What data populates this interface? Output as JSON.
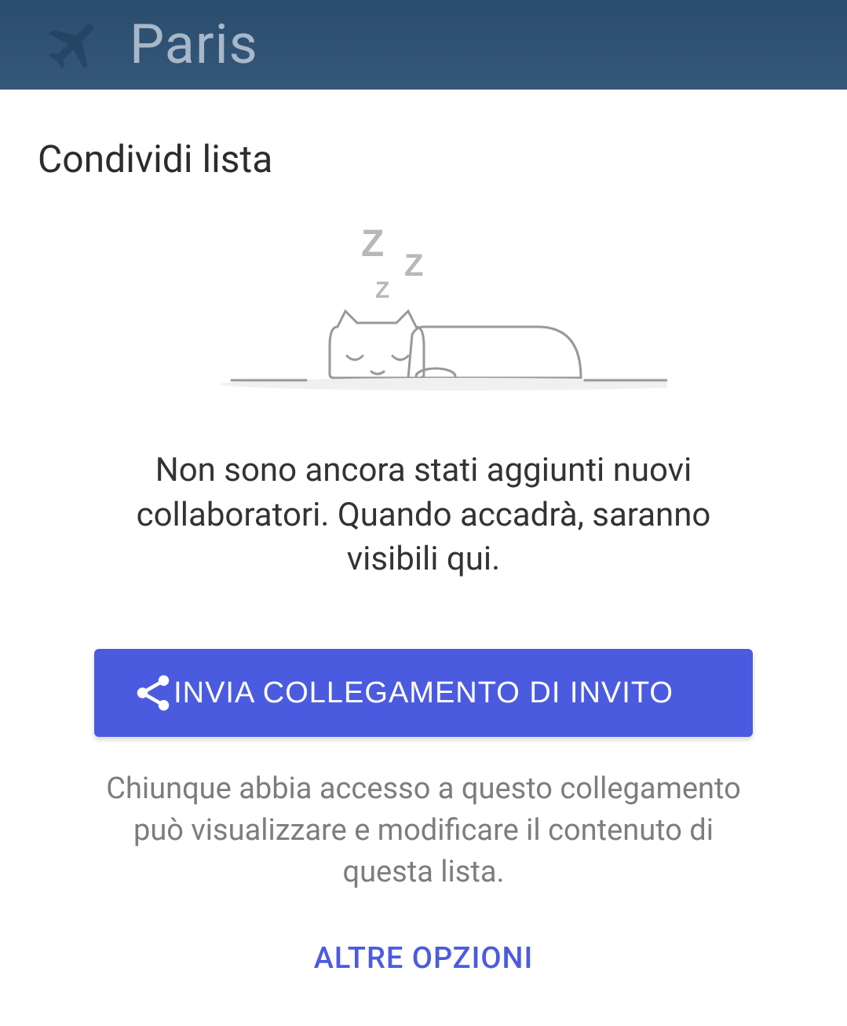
{
  "header": {
    "title": "Paris"
  },
  "page": {
    "title": "Condividi lista",
    "empty_state_message": "Non sono ancora stati aggiunti nuovi collaboratori. Quando accadrà, saranno visibili qui.",
    "invite_button_label": "INVIA COLLEGAMENTO DI INVITO",
    "access_note": "Chiunque abbia accesso a questo collegamento può visualizzare e modificare il contenuto di questa lista.",
    "more_options_label": "ALTRE OPZIONI"
  }
}
